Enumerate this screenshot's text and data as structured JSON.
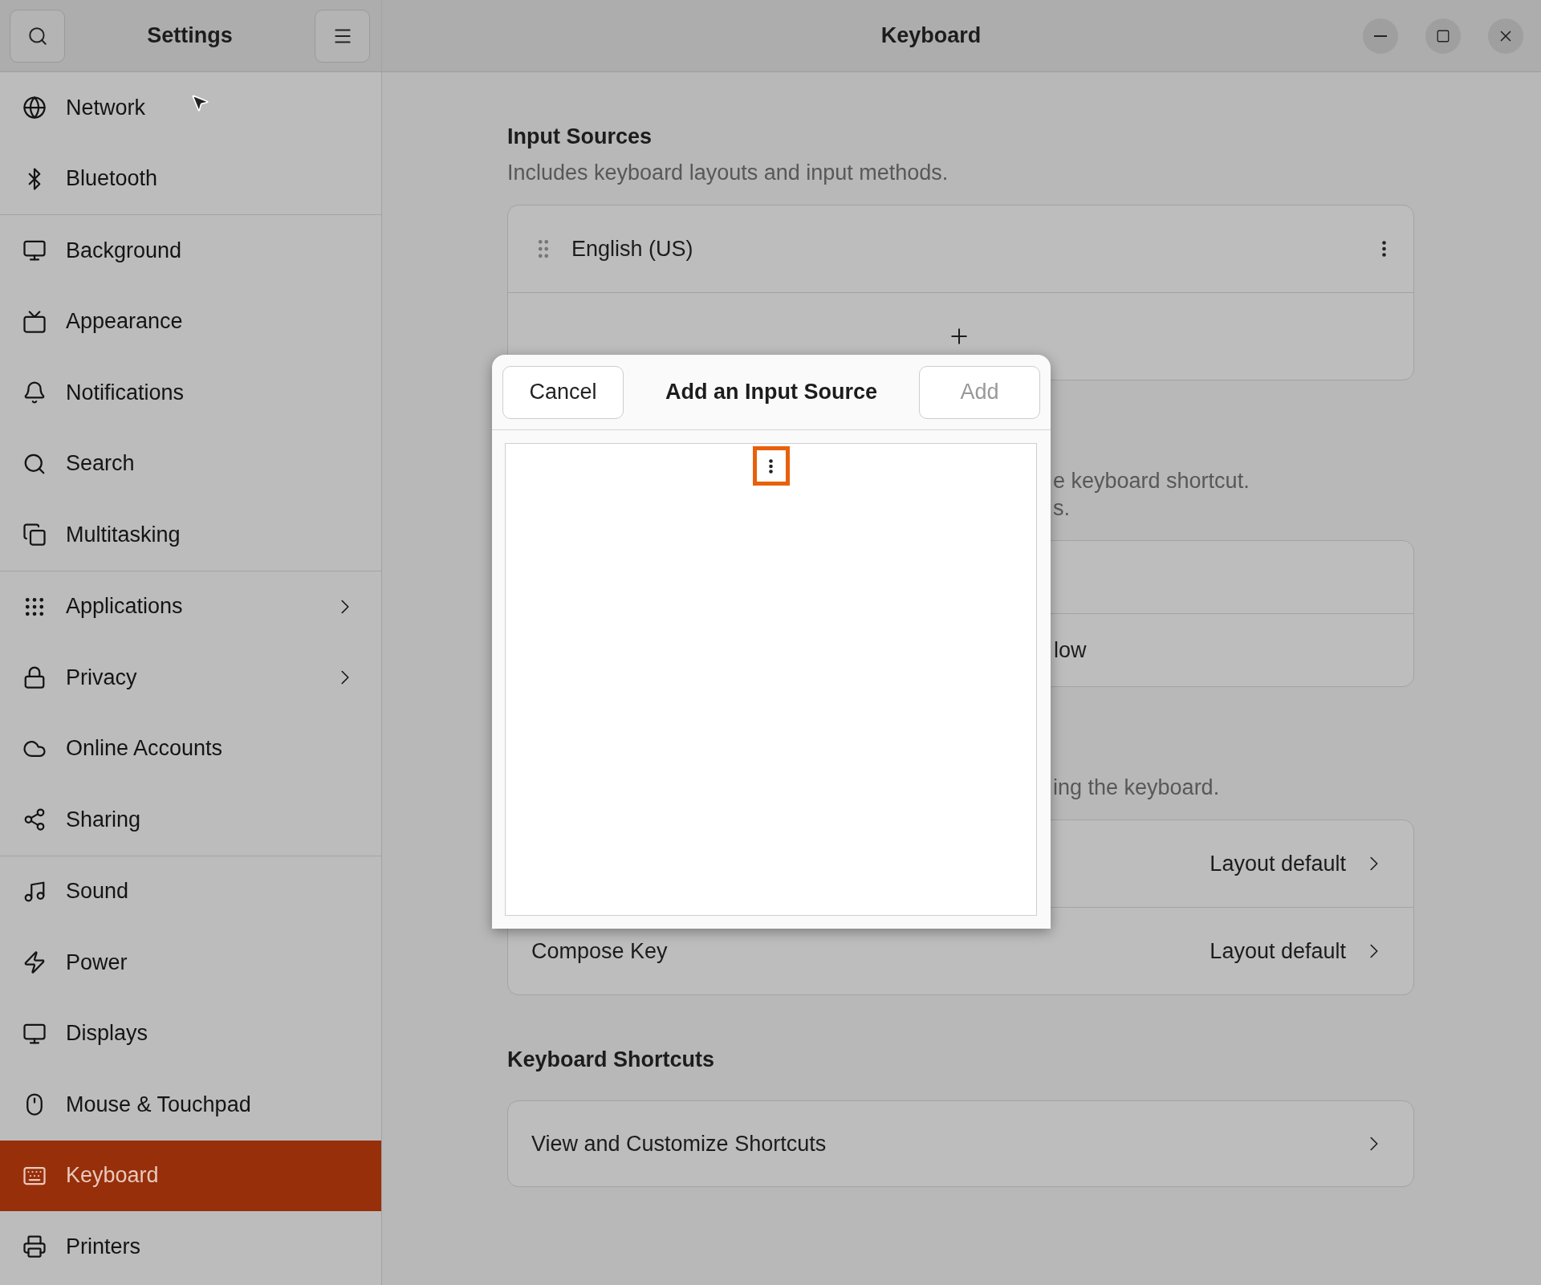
{
  "sidebar": {
    "title": "Settings",
    "groups": [
      {
        "items": [
          {
            "label": "Network",
            "selected": false,
            "has_submenu": false
          },
          {
            "label": "Bluetooth",
            "selected": false,
            "has_submenu": false
          }
        ]
      },
      {
        "items": [
          {
            "label": "Background",
            "selected": false,
            "has_submenu": false
          },
          {
            "label": "Appearance",
            "selected": false,
            "has_submenu": false
          },
          {
            "label": "Notifications",
            "selected": false,
            "has_submenu": false
          },
          {
            "label": "Search",
            "selected": false,
            "has_submenu": false
          },
          {
            "label": "Multitasking",
            "selected": false,
            "has_submenu": false
          }
        ]
      },
      {
        "items": [
          {
            "label": "Applications",
            "selected": false,
            "has_submenu": true
          },
          {
            "label": "Privacy",
            "selected": false,
            "has_submenu": true
          },
          {
            "label": "Online Accounts",
            "selected": false,
            "has_submenu": false
          },
          {
            "label": "Sharing",
            "selected": false,
            "has_submenu": false
          }
        ]
      },
      {
        "items": [
          {
            "label": "Sound",
            "selected": false,
            "has_submenu": false
          },
          {
            "label": "Power",
            "selected": false,
            "has_submenu": false
          },
          {
            "label": "Displays",
            "selected": false,
            "has_submenu": false
          },
          {
            "label": "Mouse & Touchpad",
            "selected": false,
            "has_submenu": false
          },
          {
            "label": "Keyboard",
            "selected": true,
            "has_submenu": false
          },
          {
            "label": "Printers",
            "selected": false,
            "has_submenu": false
          }
        ]
      }
    ]
  },
  "main": {
    "title": "Keyboard",
    "sections": [
      {
        "title": "Input Sources",
        "subtitle": [
          "Includes keyboard layouts and input methods."
        ],
        "rows": [
          {
            "kind": "source",
            "label": "English (US)"
          },
          {
            "kind": "add"
          }
        ]
      },
      {
        "subtitle_fragments": [
          "e keyboard shortcut.",
          "s."
        ],
        "rows": [
          {
            "kind": "blank"
          },
          {
            "kind": "fragment",
            "label": "low"
          }
        ]
      },
      {
        "subtitle_fragments": [
          "ing the keyboard."
        ],
        "rows": [
          {
            "kind": "value",
            "value": "Layout default"
          },
          {
            "kind": "value",
            "label": "Compose Key",
            "value": "Layout default"
          }
        ]
      },
      {
        "title": "Keyboard Shortcuts",
        "rows": [
          {
            "kind": "link",
            "label": "View and Customize Shortcuts"
          }
        ]
      }
    ]
  },
  "dialog": {
    "title": "Add an Input Source",
    "cancel": "Cancel",
    "add": {
      "label": "Add",
      "disabled": true
    },
    "list": {
      "more_highlighted": true
    }
  }
}
